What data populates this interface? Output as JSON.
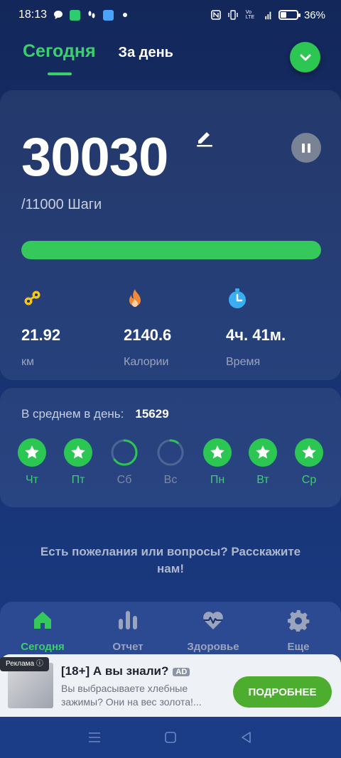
{
  "status_bar": {
    "time": "18:13",
    "battery_percent_label": "36%",
    "battery_level": 0.36,
    "network": "4G"
  },
  "header": {
    "tabs": [
      {
        "label": "Сегодня",
        "active": true
      },
      {
        "label": "За день",
        "active": false
      }
    ]
  },
  "steps": {
    "value": "30030",
    "goal_label": "/11000 Шаги",
    "progress": 1.0
  },
  "stats": [
    {
      "value": "21.92",
      "label": "км",
      "icon": "distance-icon",
      "color": "#f5c518"
    },
    {
      "value": "2140.6",
      "label": "Калории",
      "icon": "flame-icon",
      "color": "#f08a3a"
    },
    {
      "value": "4ч. 41м.",
      "label": "Время",
      "icon": "stopwatch-icon",
      "color": "#3aaef2"
    }
  ],
  "average": {
    "label": "В среднем в день:",
    "value": "15629"
  },
  "week": [
    {
      "label": "Чт",
      "state": "star"
    },
    {
      "label": "Пт",
      "state": "star"
    },
    {
      "label": "Сб",
      "state": "partial",
      "progress": 0.65
    },
    {
      "label": "Вс",
      "state": "empty",
      "progress": 0.1
    },
    {
      "label": "Пн",
      "state": "star"
    },
    {
      "label": "Вт",
      "state": "star"
    },
    {
      "label": "Ср",
      "state": "star"
    }
  ],
  "feedback": {
    "text": "Есть пожелания или вопросы? Расскажите нам!"
  },
  "nav": [
    {
      "label": "Сегодня",
      "icon": "home-icon",
      "active": true
    },
    {
      "label": "Отчет",
      "icon": "bar-chart-icon",
      "active": false
    },
    {
      "label": "Здоровье",
      "icon": "heart-pulse-icon",
      "active": false
    },
    {
      "label": "Еще",
      "icon": "gear-icon",
      "active": false
    }
  ],
  "ad": {
    "tag": "Реклама",
    "title": "[18+] А вы знали?",
    "badge": "AD",
    "body": "Вы выбрасываете хлебные зажимы? Они на вес золота!...",
    "cta": "ПОДРОБНЕЕ"
  },
  "colors": {
    "accent": "#35c85a",
    "background": "#16316e"
  }
}
